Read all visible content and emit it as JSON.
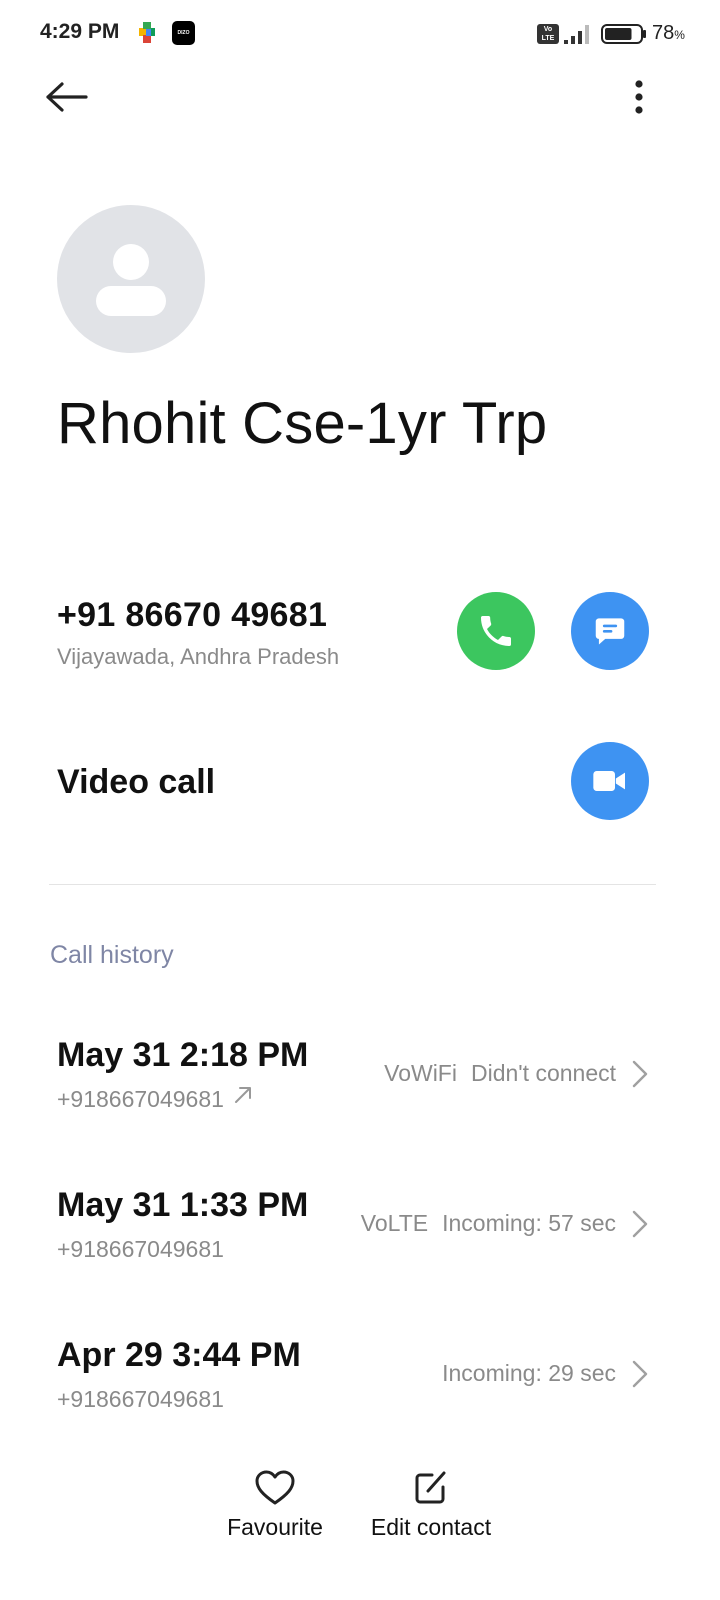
{
  "status_bar": {
    "time": "4:29 PM",
    "app_badge": "DIZO",
    "volte_badge": "Vo LTE",
    "battery_percent": "78",
    "battery_unit": "%",
    "battery_level": 0.78
  },
  "contact": {
    "name": "Rhohit Cse-1yr Trp",
    "phone": "+91 86670 49681",
    "location": "Vijayawada, Andhra Pradesh"
  },
  "actions": {
    "video_call_label": "Video call"
  },
  "call_history": {
    "title": "Call history",
    "items": [
      {
        "date": "May 31 2:18 PM",
        "number": "+918667049681",
        "network": "VoWiFi",
        "status": "Didn't connect",
        "outgoing_icon": "outgoing-arrow-icon"
      },
      {
        "date": "May 31 1:33 PM",
        "number": "+918667049681",
        "network": "VoLTE",
        "status": "Incoming: 57 sec"
      },
      {
        "date": "Apr 29 3:44 PM",
        "number": "+918667049681",
        "network": "",
        "status": "Incoming: 29 sec"
      }
    ]
  },
  "bottom_bar": {
    "favourite_label": "Favourite",
    "edit_label": "Edit contact"
  },
  "colors": {
    "call_green": "#3cc65f",
    "action_blue": "#3e93f2",
    "section_title": "#7f86a5",
    "secondary_text": "#8a8a8a"
  }
}
